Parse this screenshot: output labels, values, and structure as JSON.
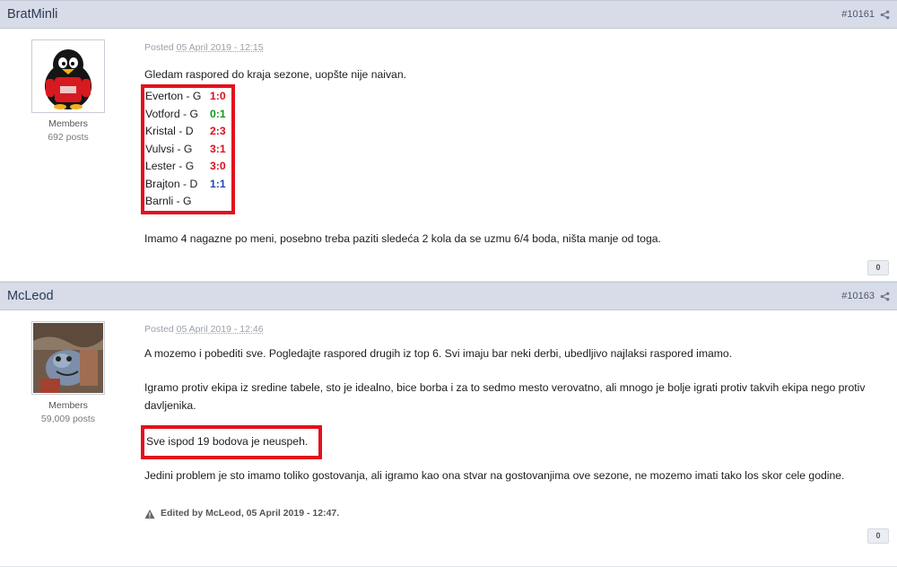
{
  "posts": [
    {
      "author": "BratMinli",
      "post_id": "#10161",
      "group": "Members",
      "post_count": "692 posts",
      "posted_label": "Posted",
      "posted_date": "05 April 2019 - 12:15",
      "intro": "Gledam raspored do kraja sezone, uopšte nije naivan.",
      "schedule": [
        {
          "match": "Everton - G",
          "score": "1:0",
          "color": "red"
        },
        {
          "match": "Votford - G",
          "score": "0:1",
          "color": "green"
        },
        {
          "match": "Kristal - D",
          "score": "2:3",
          "color": "red"
        },
        {
          "match": "Vulvsi - G",
          "score": "3:1",
          "color": "red"
        },
        {
          "match": "Lester - G",
          "score": "3:0",
          "color": "red"
        },
        {
          "match": "Brajton - D",
          "score": "1:1",
          "color": "blue"
        },
        {
          "match": "Barnli - G",
          "score": "",
          "color": ""
        }
      ],
      "closing": "Imamo 4 nagazne po meni, posebno treba paziti sledeća 2 kola da se uzmu 6/4 boda, ništa manje od toga.",
      "reputation": "0"
    },
    {
      "author": "McLeod",
      "post_id": "#10163",
      "group": "Members",
      "post_count": "59,009 posts",
      "posted_label": "Posted",
      "posted_date": "05 April 2019 - 12:46",
      "paragraph1": "A mozemo i pobediti sve. Pogledajte raspored drugih iz top 6. Svi imaju bar neki derbi, ubedljivo najlaksi raspored imamo.",
      "paragraph2": "Igramo protiv ekipa iz sredine tabele, sto je idealno, bice borba i za to sedmo mesto verovatno, ali mnogo je bolje igrati protiv takvih ekipa nego protiv davljenika.",
      "highlight": "Sve ispod 19 bodova je neuspeh.",
      "paragraph3": "Jedini problem je sto imamo toliko gostovanja, ali igramo kao ona stvar na gostovanjima ove sezone, ne mozemo imati tako los skor cele godine.",
      "edited_note": "Edited by McLeod, 05 April 2019 - 12:47.",
      "reputation": "0"
    }
  ],
  "colors": {
    "header_bg": "#d7dce8",
    "highlight_border": "#e2111d",
    "win": "#d8111b",
    "draw_green": "#0e9a1a",
    "draw_blue": "#2149b8"
  }
}
